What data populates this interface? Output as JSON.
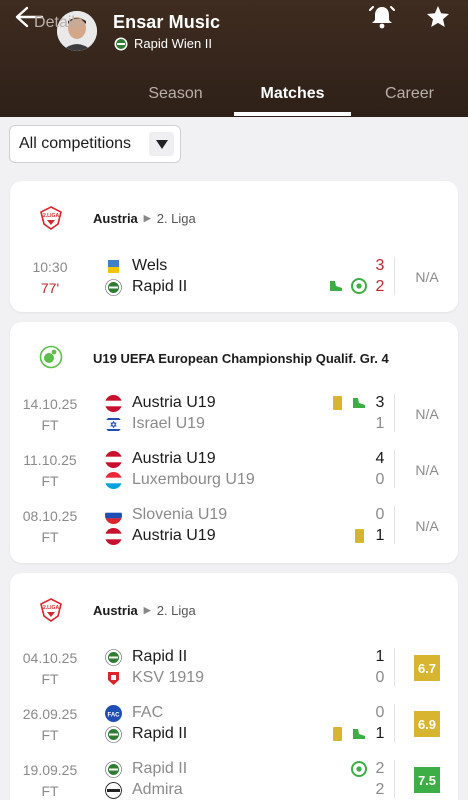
{
  "header": {
    "player_name": "Ensar Music",
    "club_name": "Rapid Wien II",
    "tabs": [
      {
        "label": "Details"
      },
      {
        "label": "Season"
      },
      {
        "label": "Matches"
      },
      {
        "label": "Career"
      }
    ],
    "active_tab": "Matches"
  },
  "filter": {
    "selected": "All competitions"
  },
  "colors": {
    "header_bg": "#3a281d",
    "live_red": "#c4262c",
    "rating_yellow": "#d8b530",
    "rating_green": "#3cae45"
  },
  "groups": [
    {
      "country": "Austria",
      "league": "2. Liga",
      "matches": [
        {
          "date": "10:30",
          "status": "77'",
          "home": "Wels",
          "away": "Rapid II",
          "home_score": "3",
          "away_score": "2",
          "rating": "N/A",
          "events": [
            "assist-boot-icon",
            "goal-ball-icon"
          ]
        }
      ]
    },
    {
      "league": "U19 UEFA European Championship Qualif. Gr. 4",
      "matches": [
        {
          "date": "14.10.25",
          "status": "FT",
          "home": "Austria U19",
          "away": "Israel U19",
          "home_score": "3",
          "away_score": "1",
          "rating": "N/A",
          "events": [
            "yellow-card",
            "assist-boot-icon"
          ]
        },
        {
          "date": "11.10.25",
          "status": "FT",
          "home": "Austria U19",
          "away": "Luxembourg U19",
          "home_score": "4",
          "away_score": "0",
          "rating": "N/A"
        },
        {
          "date": "08.10.25",
          "status": "FT",
          "home": "Slovenia U19",
          "away": "Austria U19",
          "home_score": "0",
          "away_score": "1",
          "rating": "N/A",
          "events": [
            "yellow-card"
          ]
        }
      ]
    },
    {
      "country": "Austria",
      "league": "2. Liga",
      "matches": [
        {
          "date": "04.10.25",
          "status": "FT",
          "home": "Rapid II",
          "away": "KSV 1919",
          "home_score": "1",
          "away_score": "0",
          "rating": "6.7"
        },
        {
          "date": "26.09.25",
          "status": "FT",
          "home": "FAC",
          "away": "Rapid II",
          "home_score": "0",
          "away_score": "1",
          "rating": "6.9",
          "events": [
            "yellow-card",
            "assist-boot-icon"
          ]
        },
        {
          "date": "19.09.25",
          "status": "FT",
          "home": "Rapid II",
          "away": "Admira",
          "home_score": "2",
          "away_score": "2",
          "rating": "7.5",
          "events": [
            "goal-ball-icon"
          ]
        }
      ]
    }
  ]
}
